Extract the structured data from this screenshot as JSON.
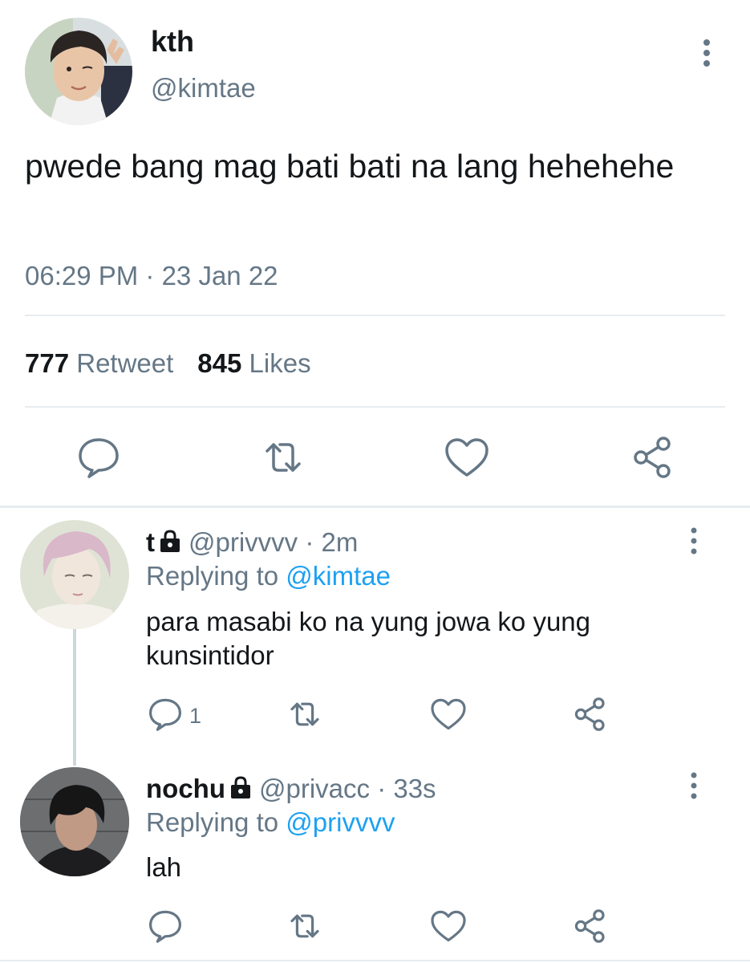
{
  "tweet": {
    "display_name": "kth",
    "handle": "@kimtae",
    "text": "pwede bang mag bati bati na lang hehehehe",
    "timestamp": "06:29 PM · 23 Jan 22",
    "retweet_count": "777",
    "retweet_label": "Retweet",
    "like_count": "845",
    "like_label": "Likes"
  },
  "replies": [
    {
      "display_name": "t",
      "handle": "@privvvv",
      "time": "· 2m",
      "replying_prefix": "Replying to",
      "replying_to": "@kimtae",
      "text": "para masabi ko na yung jowa ko yung kunsintidor",
      "reply_count": "1"
    },
    {
      "display_name": "nochu",
      "handle": "@privacc",
      "time": "· 33s",
      "replying_prefix": "Replying to",
      "replying_to": "@privvvv",
      "text": "lah",
      "reply_count": ""
    }
  ],
  "icons": {
    "more": "more-vertical-icon",
    "reply": "reply-bubble-icon",
    "retweet": "retweet-icon",
    "like": "heart-icon",
    "share": "share-icon",
    "lock": "lock-icon"
  },
  "colors": {
    "text": "#14171a",
    "secondary": "#657786",
    "link": "#1da1f2",
    "divider": "#e6ecf0"
  }
}
